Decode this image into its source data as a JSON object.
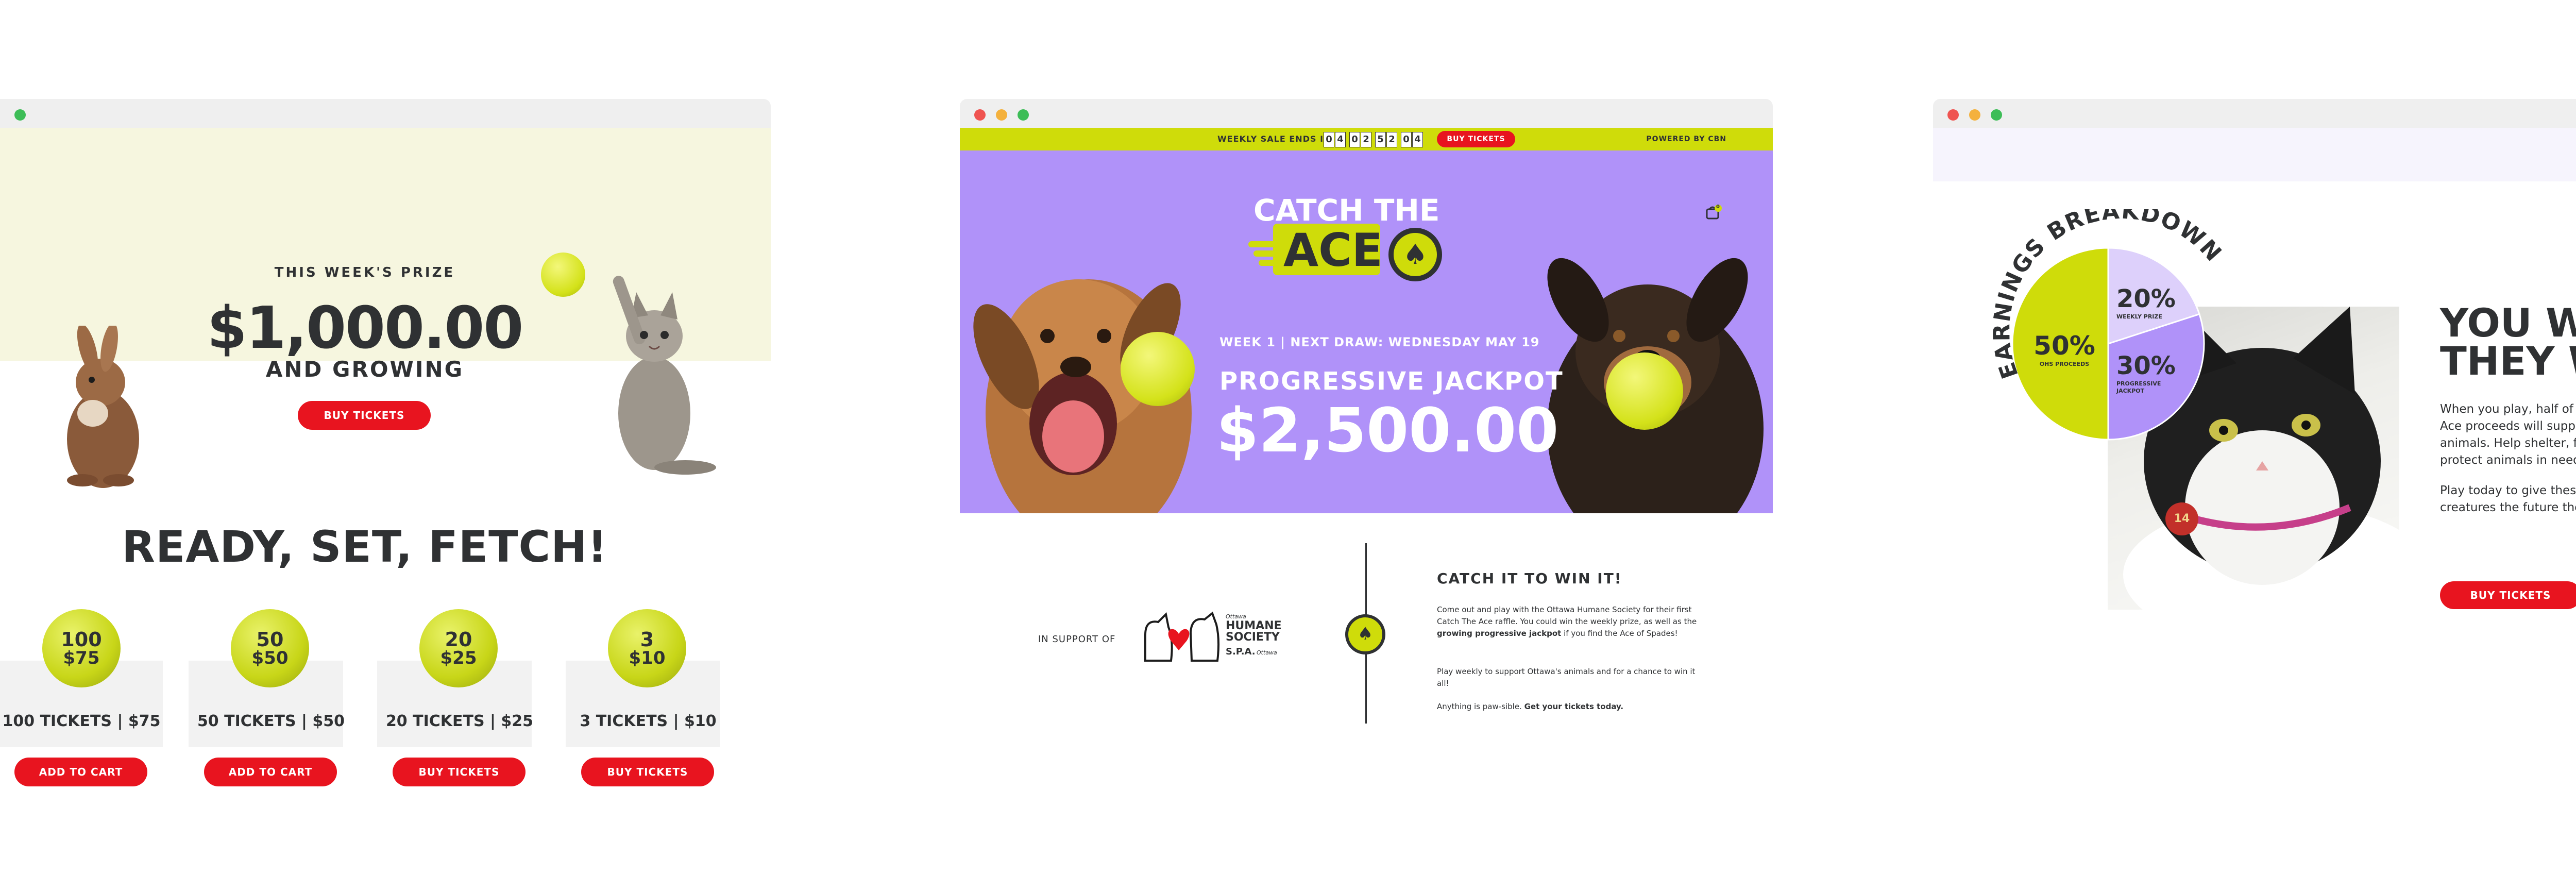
{
  "left_window": {
    "prize_label": "THIS WEEK'S PRIZE",
    "prize_amount": "$1,000.00",
    "prize_sub": "AND GROWING",
    "hero_button": "BUY TICKETS",
    "heading": "READY, SET, FETCH!",
    "tiers": [
      {
        "qty": "100",
        "price": "$75",
        "label": "100 TICKETS | $75",
        "button": "ADD TO CART"
      },
      {
        "qty": "50",
        "price": "$50",
        "label": "50 TICKETS | $50",
        "button": "ADD TO CART"
      },
      {
        "qty": "20",
        "price": "$25",
        "label": "20 TICKETS | $25",
        "button": "BUY TICKETS"
      },
      {
        "qty": "3",
        "price": "$10",
        "label": "3 TICKETS | $10",
        "button": "BUY TICKETS"
      }
    ]
  },
  "middle_window": {
    "sale_label": "WEEKLY SALE ENDS IN:",
    "countdown_digits": [
      "0",
      "4",
      "0",
      "2",
      "5",
      "2",
      "0",
      "4"
    ],
    "topbar_button": "BUY TICKETS",
    "powered_by": "POWERED BY CBN",
    "logo_catch_the": "CATCH THE",
    "logo_ace": "ACE",
    "cart_count": "0",
    "week_line": "WEEK 1  |  NEXT DRAW: WEDNESDAY MAY 19",
    "jackpot_label": "PROGRESSIVE JACKPOT",
    "jackpot_amount": "$2,500.00",
    "support_label": "IN SUPPORT OF",
    "society_small": "Ottawa",
    "society_name_1": "HUMANE",
    "society_name_2": "SOCIETY",
    "society_spa": "S.P.A.",
    "society_city": "Ottawa",
    "catch_heading": "CATCH IT TO WIN IT!",
    "para1_a": "Come out and play with the Ottawa Humane Society for their first Catch The Ace raffle. You could win the weekly prize, as well as the ",
    "para1_b": "growing progressive jackpot",
    "para1_c": " if you find the Ace of Spades!",
    "para2": "Play weekly to support Ottawa's animals and for a chance to win it all!",
    "para3_a": "Anything is paw-sible. ",
    "para3_b": "Get your tickets today."
  },
  "right_window": {
    "breakdown_title": "EARNINGS BREAKDOWN",
    "pie": [
      {
        "pct": "50%",
        "label": "OHS PROCEEDS",
        "value": 50,
        "color": "#cfdc0a"
      },
      {
        "pct": "20%",
        "label": "WEEKLY PRIZE",
        "value": 20,
        "color": "#ddd0fb"
      },
      {
        "pct": "30%",
        "label": "PROGRESSIVE JACKPOT",
        "value": 30,
        "color": "#b092f9"
      }
    ],
    "title_line1": "YOU WIN,",
    "title_line2": "THEY WIN",
    "para1": "When you play, half of the Catch the Ace proceeds will support Ottawa's animals. Help shelter, feed and protect animals in need.",
    "para2": "Play today to give these loving creatures the future they deserve.",
    "button": "BUY TICKETS",
    "cat_tag": "14"
  },
  "colors": {
    "accent_red": "#e8141f",
    "lime": "#cfdc0a",
    "purple": "#b092f9",
    "cream": "#f6f6df",
    "dark": "#2f3133"
  }
}
